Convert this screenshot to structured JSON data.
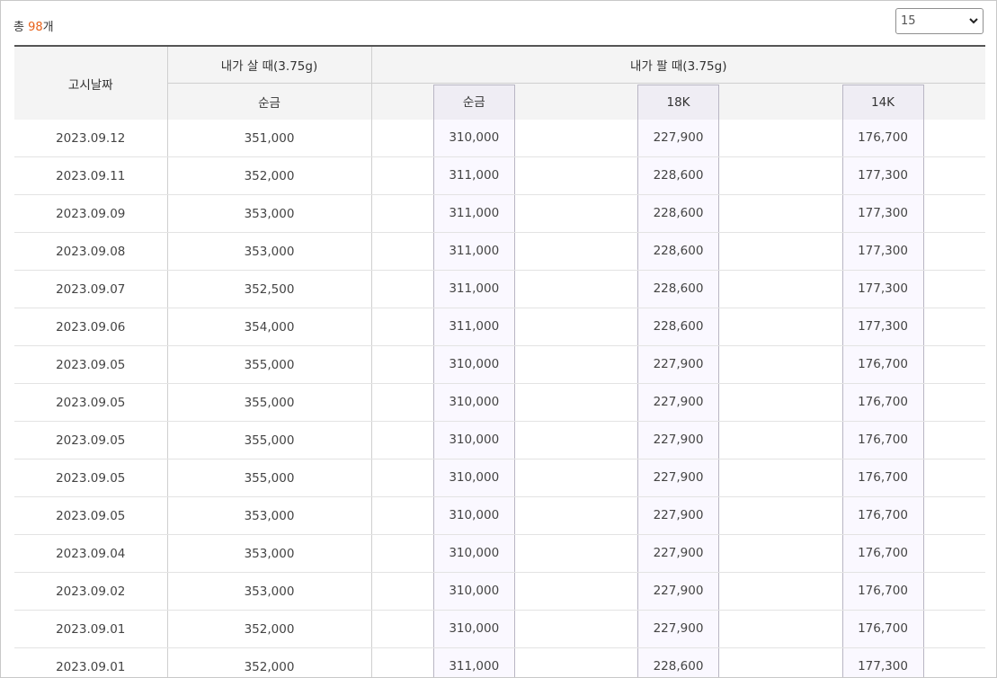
{
  "summary": {
    "prefix": "총 ",
    "count": "98",
    "suffix": "개"
  },
  "page_size": {
    "selected": "15"
  },
  "table": {
    "headers": {
      "date": "고시날짜",
      "buy_group": "내가 살 때(3.75g)",
      "sell_group": "내가 팔 때(3.75g)",
      "buy_pure": "순금",
      "sell_pure": "순금",
      "sell_18k": "18K",
      "sell_14k": "14K"
    },
    "rows": [
      {
        "date": "2023.09.12",
        "buy": "351,000",
        "pure": "310,000",
        "k18": "227,900",
        "k14": "176,700"
      },
      {
        "date": "2023.09.11",
        "buy": "352,000",
        "pure": "311,000",
        "k18": "228,600",
        "k14": "177,300"
      },
      {
        "date": "2023.09.09",
        "buy": "353,000",
        "pure": "311,000",
        "k18": "228,600",
        "k14": "177,300"
      },
      {
        "date": "2023.09.08",
        "buy": "353,000",
        "pure": "311,000",
        "k18": "228,600",
        "k14": "177,300"
      },
      {
        "date": "2023.09.07",
        "buy": "352,500",
        "pure": "311,000",
        "k18": "228,600",
        "k14": "177,300"
      },
      {
        "date": "2023.09.06",
        "buy": "354,000",
        "pure": "311,000",
        "k18": "228,600",
        "k14": "177,300"
      },
      {
        "date": "2023.09.05",
        "buy": "355,000",
        "pure": "310,000",
        "k18": "227,900",
        "k14": "176,700"
      },
      {
        "date": "2023.09.05",
        "buy": "355,000",
        "pure": "310,000",
        "k18": "227,900",
        "k14": "176,700"
      },
      {
        "date": "2023.09.05",
        "buy": "355,000",
        "pure": "310,000",
        "k18": "227,900",
        "k14": "176,700"
      },
      {
        "date": "2023.09.05",
        "buy": "355,000",
        "pure": "310,000",
        "k18": "227,900",
        "k14": "176,700"
      },
      {
        "date": "2023.09.05",
        "buy": "353,000",
        "pure": "310,000",
        "k18": "227,900",
        "k14": "176,700"
      },
      {
        "date": "2023.09.04",
        "buy": "353,000",
        "pure": "310,000",
        "k18": "227,900",
        "k14": "176,700"
      },
      {
        "date": "2023.09.02",
        "buy": "353,000",
        "pure": "310,000",
        "k18": "227,900",
        "k14": "176,700"
      },
      {
        "date": "2023.09.01",
        "buy": "352,000",
        "pure": "310,000",
        "k18": "227,900",
        "k14": "176,700"
      },
      {
        "date": "2023.09.01",
        "buy": "352,000",
        "pure": "311,000",
        "k18": "228,600",
        "k14": "177,300"
      }
    ]
  },
  "colors": {
    "accent": "#e8611a",
    "highlight_column": "#faf8ff",
    "header_bg": "#f4f4f4"
  }
}
